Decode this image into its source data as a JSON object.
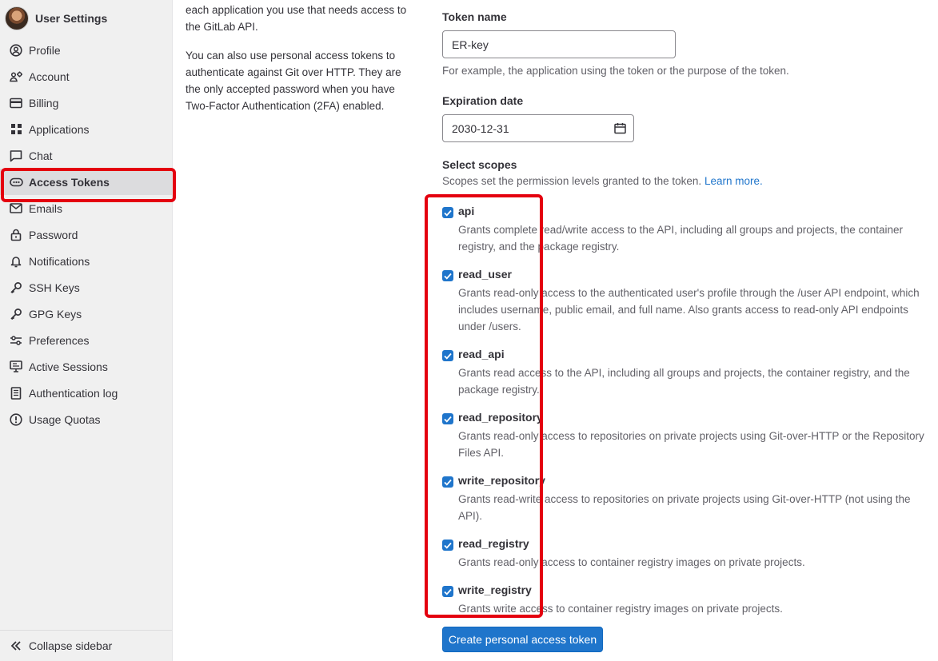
{
  "sidebar": {
    "title": "User Settings",
    "items": [
      {
        "label": "Profile",
        "icon": "profile-icon"
      },
      {
        "label": "Account",
        "icon": "account-icon"
      },
      {
        "label": "Billing",
        "icon": "billing-icon"
      },
      {
        "label": "Applications",
        "icon": "applications-icon"
      },
      {
        "label": "Chat",
        "icon": "chat-icon"
      },
      {
        "label": "Access Tokens",
        "icon": "token-icon"
      },
      {
        "label": "Emails",
        "icon": "email-icon"
      },
      {
        "label": "Password",
        "icon": "lock-icon"
      },
      {
        "label": "Notifications",
        "icon": "bell-icon"
      },
      {
        "label": "SSH Keys",
        "icon": "key-icon"
      },
      {
        "label": "GPG Keys",
        "icon": "key-icon"
      },
      {
        "label": "Preferences",
        "icon": "preferences-icon"
      },
      {
        "label": "Active Sessions",
        "icon": "monitor-icon"
      },
      {
        "label": "Authentication log",
        "icon": "log-icon"
      },
      {
        "label": "Usage Quotas",
        "icon": "quota-icon"
      }
    ],
    "active_index": 5,
    "collapse_label": "Collapse sidebar"
  },
  "description": {
    "p1": "each application you use that needs access to the GitLab API.",
    "p2": "You can also use personal access tokens to authenticate against Git over HTTP. They are the only accepted password when you have Two-Factor Authentication (2FA) enabled."
  },
  "form": {
    "token_name_label": "Token name",
    "token_name_value": "ER-key",
    "token_name_help": "For example, the application using the token or the purpose of the token.",
    "expiration_label": "Expiration date",
    "expiration_value": "2030-12-31",
    "scopes_label": "Select scopes",
    "scopes_help": "Scopes set the permission levels granted to the token.",
    "scopes_learn_more": "Learn more.",
    "scopes": [
      {
        "name": "api",
        "checked": true,
        "desc": "Grants complete read/write access to the API, including all groups and projects, the container registry, and the package registry."
      },
      {
        "name": "read_user",
        "checked": true,
        "desc": "Grants read-only access to the authenticated user's profile through the /user API endpoint, which includes username, public email, and full name. Also grants access to read-only API endpoints under /users."
      },
      {
        "name": "read_api",
        "checked": true,
        "desc": "Grants read access to the API, including all groups and projects, the container registry, and the package registry."
      },
      {
        "name": "read_repository",
        "checked": true,
        "desc": "Grants read-only access to repositories on private projects using Git-over-HTTP or the Repository Files API."
      },
      {
        "name": "write_repository",
        "checked": true,
        "desc": "Grants read-write access to repositories on private projects using Git-over-HTTP (not using the API)."
      },
      {
        "name": "read_registry",
        "checked": true,
        "desc": "Grants read-only access to container registry images on private projects."
      },
      {
        "name": "write_registry",
        "checked": true,
        "desc": "Grants write access to container registry images on private projects."
      }
    ],
    "create_button": "Create personal access token"
  },
  "colors": {
    "accent": "#1f75cb",
    "highlight": "#e4000f",
    "sidebar_bg": "#f0f0f0"
  }
}
